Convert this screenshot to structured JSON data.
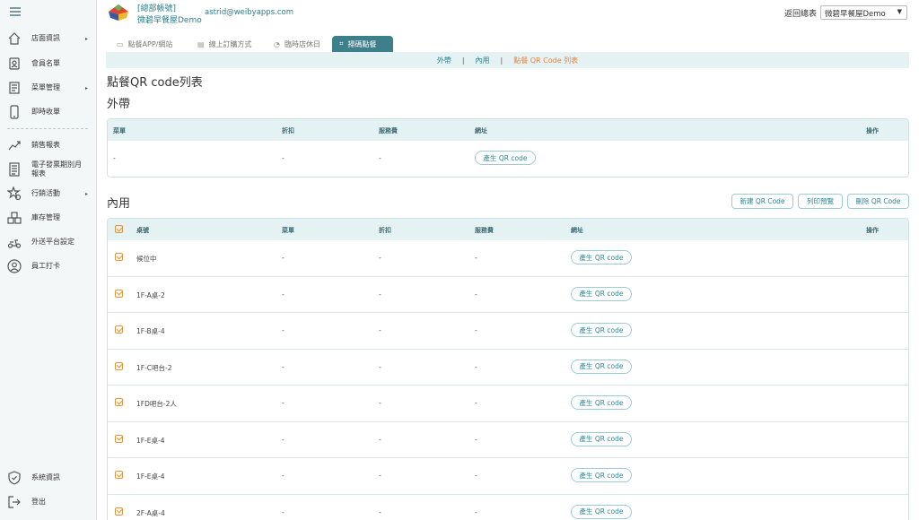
{
  "sidebar": {
    "items": [
      {
        "label": "店面資訊",
        "icon": "house-icon",
        "arrow": "▸"
      },
      {
        "label": "會員名單",
        "icon": "member-card-icon",
        "arrow": ""
      },
      {
        "label": "菜單管理",
        "icon": "menu-book-icon",
        "arrow": "▸"
      },
      {
        "label": "即時收單",
        "icon": "phone-icon",
        "arrow": ""
      },
      {
        "label": "銷售報表",
        "icon": "trend-chart-icon",
        "arrow": ""
      },
      {
        "label": "電子發票期別月報表",
        "icon": "document-icon",
        "arrow": ""
      },
      {
        "label": "行銷活動",
        "icon": "star-gear-icon",
        "arrow": "▸"
      },
      {
        "label": "庫存管理",
        "icon": "boxes-icon",
        "arrow": ""
      },
      {
        "label": "外送平台設定",
        "icon": "scooter-icon",
        "arrow": ""
      },
      {
        "label": "員工打卡",
        "icon": "staff-icon",
        "arrow": ""
      },
      {
        "label": "系統資訊",
        "icon": "shield-icon",
        "arrow": ""
      },
      {
        "label": "登出",
        "icon": "logout-icon",
        "arrow": ""
      }
    ]
  },
  "header": {
    "account_type": "[總部帳號]",
    "store_name": "微碧早餐屋Demo",
    "email": "astrid@weibyapps.com",
    "back_link": "返回總表",
    "store_select": "微碧早餐屋Demo",
    "select_caret": "▼"
  },
  "tabs": [
    {
      "label": "點餐APP/網站",
      "icon": "▭"
    },
    {
      "label": "線上訂購方式",
      "icon": "▤"
    },
    {
      "label": "臨時店休日",
      "icon": "◔"
    },
    {
      "label": "掃碼點餐",
      "icon": "⌗"
    }
  ],
  "subtabs": {
    "takeout": "外帶",
    "dinein": "內用",
    "qrlist": "點餐 QR Code 列表",
    "sep": "|"
  },
  "page_title": "點餐QR code列表",
  "takeout": {
    "title": "外帶",
    "headers": {
      "menu": "菜單",
      "discount": "折扣",
      "fee": "服務費",
      "url": "網址",
      "action": "操作"
    },
    "rows": [
      {
        "menu": "-",
        "discount": "-",
        "fee": "-",
        "btn": "產生 QR code"
      }
    ]
  },
  "dinein": {
    "title": "內用",
    "actions": {
      "new": "新建 QR Code",
      "print": "列印預覽",
      "delete": "刪除 QR Code"
    },
    "headers": {
      "table": "桌號",
      "menu": "菜單",
      "discount": "折扣",
      "fee": "服務費",
      "url": "網址",
      "action": "操作"
    },
    "rows": [
      {
        "table": "候位中",
        "menu": "-",
        "discount": "-",
        "fee": "-",
        "btn": "產生 QR code"
      },
      {
        "table": "1F-A桌-2",
        "menu": "-",
        "discount": "-",
        "fee": "-",
        "btn": "產生 QR code"
      },
      {
        "table": "1F-B桌-4",
        "menu": "-",
        "discount": "-",
        "fee": "-",
        "btn": "產生 QR code"
      },
      {
        "table": "1F-C吧台-2",
        "menu": "-",
        "discount": "-",
        "fee": "-",
        "btn": "產生 QR code"
      },
      {
        "table": "1FD吧台-2人",
        "menu": "-",
        "discount": "-",
        "fee": "-",
        "btn": "產生 QR code"
      },
      {
        "table": "1F-E桌-4",
        "menu": "-",
        "discount": "-",
        "fee": "-",
        "btn": "產生 QR code"
      },
      {
        "table": "1F-E桌-4",
        "menu": "-",
        "discount": "-",
        "fee": "-",
        "btn": "產生 QR code"
      },
      {
        "table": "2F-A桌-4",
        "menu": "-",
        "discount": "-",
        "fee": "-",
        "btn": "產生 QR code"
      }
    ]
  }
}
